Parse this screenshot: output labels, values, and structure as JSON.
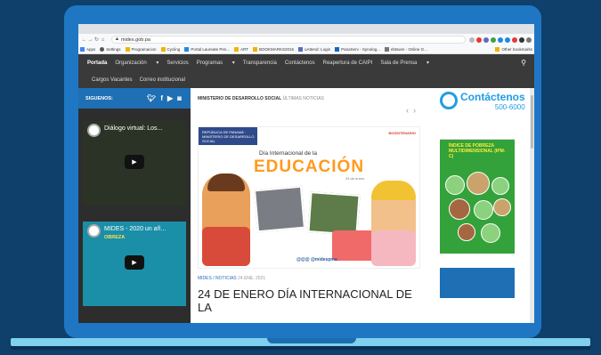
{
  "browser": {
    "url": "mides.gob.pa",
    "bookmarks": [
      "Apps",
      "Settings",
      "Programacion",
      "Cycling",
      "Portal Laureate Pen...",
      "ART",
      "BOOKMARKS2016",
      "uAttend: Login",
      "PanaServ - Synolog...",
      "ebtswsr - Online G..."
    ],
    "other_bookmarks": "Other bookmarks"
  },
  "nav": {
    "row1": [
      "Portada",
      "Organización",
      "Servicios",
      "Programas",
      "Transparencia",
      "Contáctenos",
      "Reapertura de CAIPI",
      "Sala de Prensa"
    ],
    "row2": [
      "Cargos Vacantes",
      "Correo institucional"
    ]
  },
  "sidebar": {
    "follow_label": "SIGUENOS:",
    "videos": [
      {
        "title": "Diálogo virtual: Los...",
        "subtitle": ""
      },
      {
        "title": "MIDES - 2020 un añ...",
        "subtitle": "OBREZA"
      }
    ]
  },
  "main": {
    "crumb_section": "MINISTERIO DE DESARROLLO SOCIAL",
    "crumb_sub": "ÚLTIMAS NOTICIAS",
    "banner": {
      "gov_label": "REPÚBLICA DE PANAMÁ · MINISTERIO DE DESARROLLO SOCIAL",
      "bicentenario": "BICENTENARIO",
      "dia": "Día Internacional de la",
      "educacion": "EDUCACIÓN",
      "fecha": "24 de enero",
      "handle": "@@@ @midespma"
    },
    "tag": "MIDES / NOTICIAS",
    "tag_date": "24 ENE, 2021",
    "headline": "24 DE ENERO DÍA INTERNACIONAL DE LA"
  },
  "right": {
    "contact_title": "Contáctenos",
    "contact_phone": "500-6000",
    "ipm_title": "ÍNDICE DE POBREZA MULTIDIMENSIONAL (IPM-C)"
  },
  "colors": {
    "page_bg": "#0f3f6b",
    "laptop": "#1f77c4",
    "accent": "#1f6fb5"
  }
}
